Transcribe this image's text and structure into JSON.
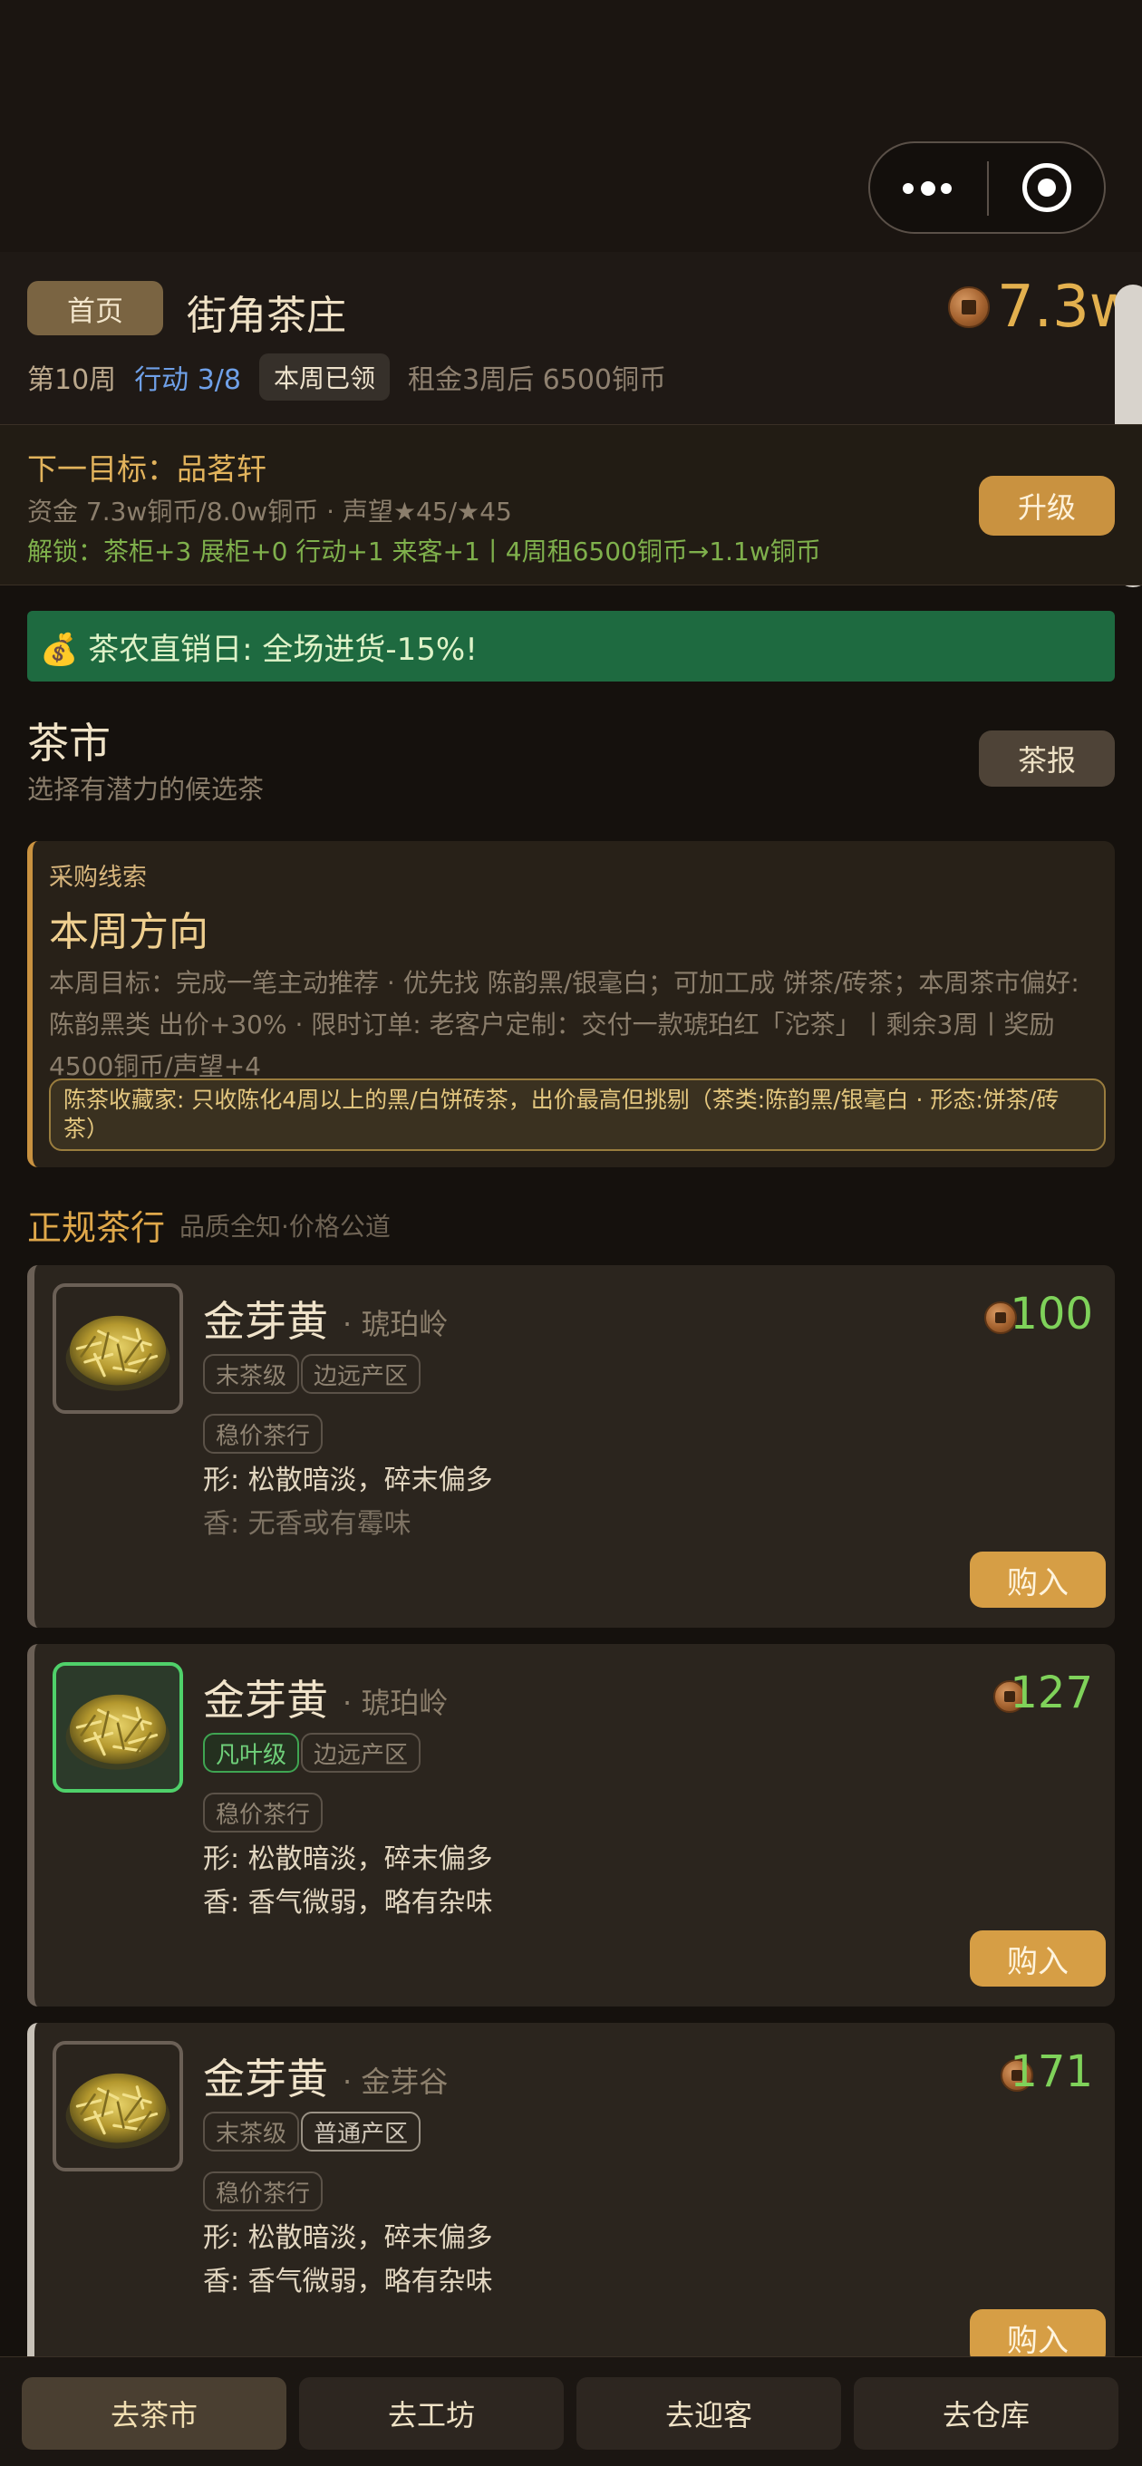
{
  "capsule": {
    "more_icon": "more-dots-icon",
    "close_icon": "target-icon"
  },
  "header": {
    "home_label": "首页",
    "shop_name": "街角茶庄",
    "money": "7.3w",
    "week": "第10周",
    "action": "行动 3/8",
    "claimed": "本周已领",
    "rent": "租金3周后 6500铜币"
  },
  "goal": {
    "title": "下一目标：品茗轩",
    "funds": "资金 7.3w铜币/8.0w铜币 · 声望★45/★45",
    "unlock": "解锁：茶柜+3 展柜+0 行动+1 来客+1丨4周租6500铜币→1.1w铜币",
    "upgrade_label": "升级"
  },
  "banner": {
    "icon": "money-bag-icon",
    "text": "💰 茶农直销日: 全场进货-15%!"
  },
  "market": {
    "title": "茶市",
    "subtitle": "选择有潜力的候选茶",
    "news_label": "茶报"
  },
  "clue": {
    "tag": "采购线索",
    "heading": "本周方向",
    "desc": "本周目标：完成一笔主动推荐 · 优先找 陈韵黑/银毫白；可加工成 饼茶/砖茶；本周茶市偏好: 陈韵黑类 出价+30% · 限时订单: 老客户定制：交付一款琥珀红「沱茶」丨剩余3周丨奖励4500铜币/声望+4",
    "note": "陈茶收藏家: 只收陈化4周以上的黑/白饼砖茶，出价最高但挑剔（茶类:陈韵黑/银毫白 · 形态:饼茶/砖茶）"
  },
  "shop": {
    "title": "正规茶行",
    "subtitle": "品质全知·价格公道"
  },
  "cards": [
    {
      "name": "金芽黄",
      "origin": "· 琥珀岭",
      "price": "100",
      "grade": "末茶级",
      "region": "边远产区",
      "dealer": "稳价茶行",
      "form": "形: 松散暗淡，碎末偏多",
      "aroma": "香: 无香或有霉味",
      "buy": "购入"
    },
    {
      "name": "金芽黄",
      "origin": "· 琥珀岭",
      "price": "127",
      "grade": "凡叶级",
      "region": "边远产区",
      "dealer": "稳价茶行",
      "form": "形: 松散暗淡，碎末偏多",
      "aroma": "香: 香气微弱，略有杂味",
      "buy": "购入"
    },
    {
      "name": "金芽黄",
      "origin": "· 金芽谷",
      "price": "171",
      "grade": "末茶级",
      "region": "普通产区",
      "dealer": "稳价茶行",
      "form": "形: 松散暗淡，碎末偏多",
      "aroma": "香: 香气微弱，略有杂味",
      "buy": "购入"
    }
  ],
  "tabs": [
    "去茶市",
    "去工坊",
    "去迎客",
    "去仓库"
  ],
  "colors": {
    "accent": "#c99240",
    "price_green": "#7fd25a",
    "banner_green": "#1e6a40",
    "grade_green": "#4fd16a"
  }
}
